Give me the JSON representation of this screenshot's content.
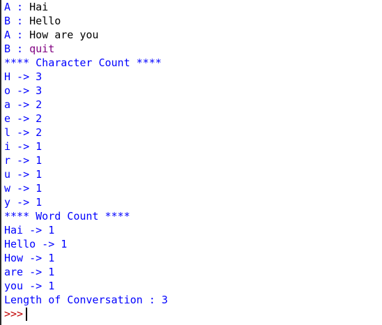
{
  "conversation": [
    {
      "speaker": "A",
      "sep": " : ",
      "text": "Hai",
      "style": "input"
    },
    {
      "speaker": "B",
      "sep": " : ",
      "text": "Hello",
      "style": "input"
    },
    {
      "speaker": "A",
      "sep": " : ",
      "text": "How are you",
      "style": "input"
    },
    {
      "speaker": "B",
      "sep": " : ",
      "text": "quit",
      "style": "quit"
    }
  ],
  "char_header": "**** Character Count ****",
  "char_counts": [
    "H -> 3",
    "o -> 3",
    "a -> 2",
    "e -> 2",
    "l -> 2",
    "i -> 1",
    "r -> 1",
    "u -> 1",
    "w -> 1",
    "y -> 1"
  ],
  "word_header": "**** Word Count ****",
  "word_counts": [
    "Hai -> 1",
    "Hello -> 1",
    "How -> 1",
    "are -> 1",
    "you -> 1"
  ],
  "length_line": "Length of Conversation : 3",
  "prompt": ">>>",
  "colors": {
    "output": "#0000ff",
    "input": "#000000",
    "quit": "#800080",
    "prompt": "#c00000"
  }
}
